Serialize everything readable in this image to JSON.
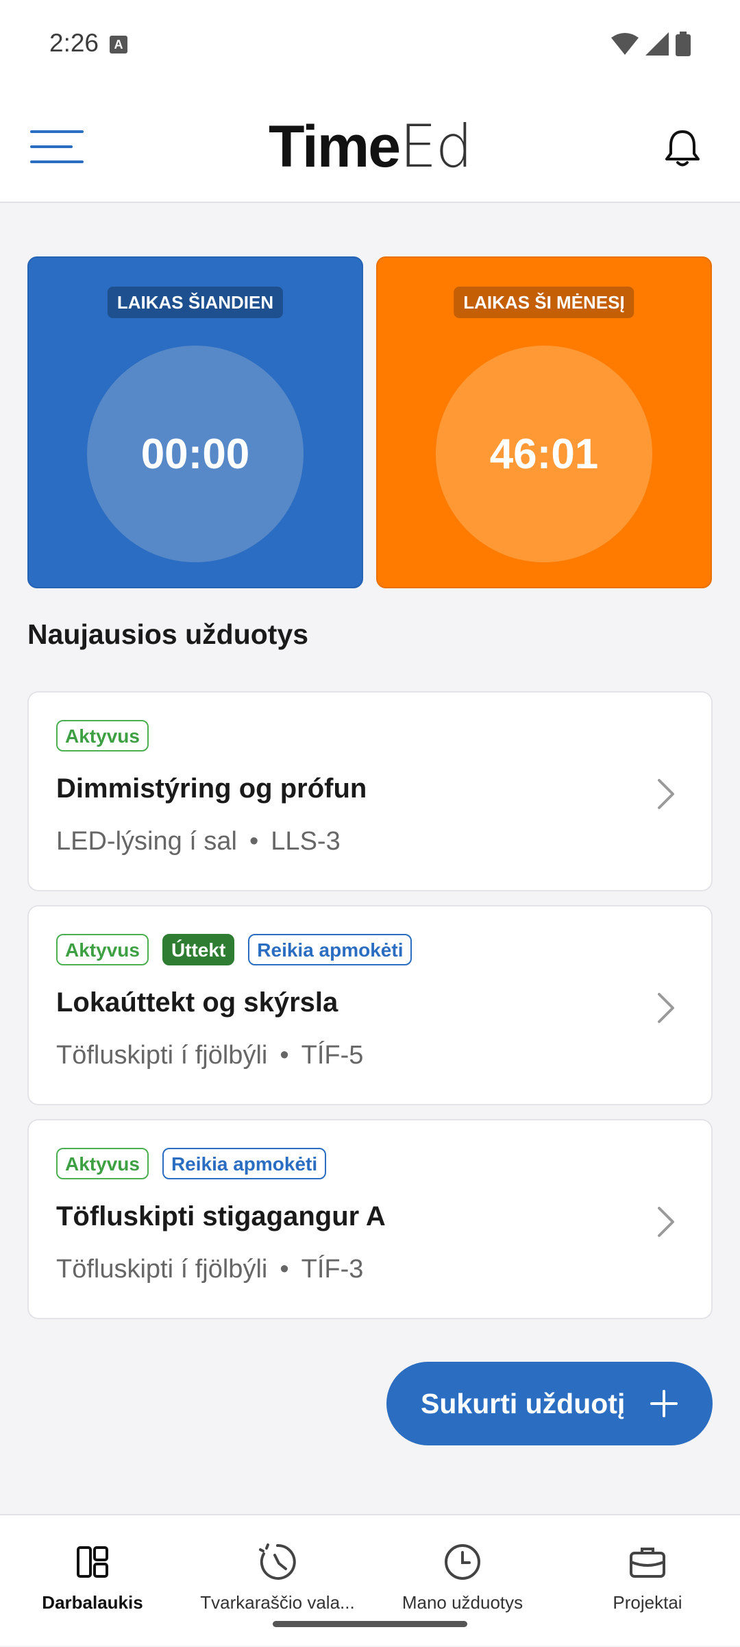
{
  "status_bar": {
    "time": "2:26",
    "notification_icon": "a-icon"
  },
  "app_bar": {
    "brand_bold": "Time",
    "brand_light": "Ed"
  },
  "stats": {
    "today": {
      "label": "LAIKAS ŠIANDIEN",
      "value": "00:00",
      "color": "#2B6DC2"
    },
    "month": {
      "label": "LAIKAS ŠI MĖNESĮ",
      "value": "46:01",
      "color": "#FF7B00"
    }
  },
  "section_title": "Naujausios užduotys",
  "tasks": [
    {
      "badges": [
        "Aktyvus"
      ],
      "title": "Dimmistýring og prófun",
      "project": "LED-lýsing í sal",
      "code": "LLS-3"
    },
    {
      "badges": [
        "Aktyvus",
        "Úttekt",
        "Reikia apmokėti"
      ],
      "title": "Lokaúttekt og skýrsla",
      "project": "Töfluskipti í fjölbýli",
      "code": "TÍF-5"
    },
    {
      "badges": [
        "Aktyvus",
        "Reikia apmokėti"
      ],
      "title": "Töfluskipti stigagangur A",
      "project": "Töfluskipti í fjölbýli",
      "code": "TÍF-3"
    }
  ],
  "fab_label": "Sukurti užduotį",
  "separator": "•",
  "nav": [
    {
      "label": "Darbalaukis",
      "icon": "dashboard-icon",
      "active": true
    },
    {
      "label": "Tvarkaraščio vala...",
      "icon": "schedule-clock-icon",
      "active": false
    },
    {
      "label": "Mano užduotys",
      "icon": "clock-icon",
      "active": false
    },
    {
      "label": "Projektai",
      "icon": "briefcase-icon",
      "active": false
    }
  ],
  "colors": {
    "primary": "#2A6DC1",
    "accent_orange": "#FF7B00",
    "active_green": "#4CAF50",
    "audit_green": "#2E7D32"
  }
}
